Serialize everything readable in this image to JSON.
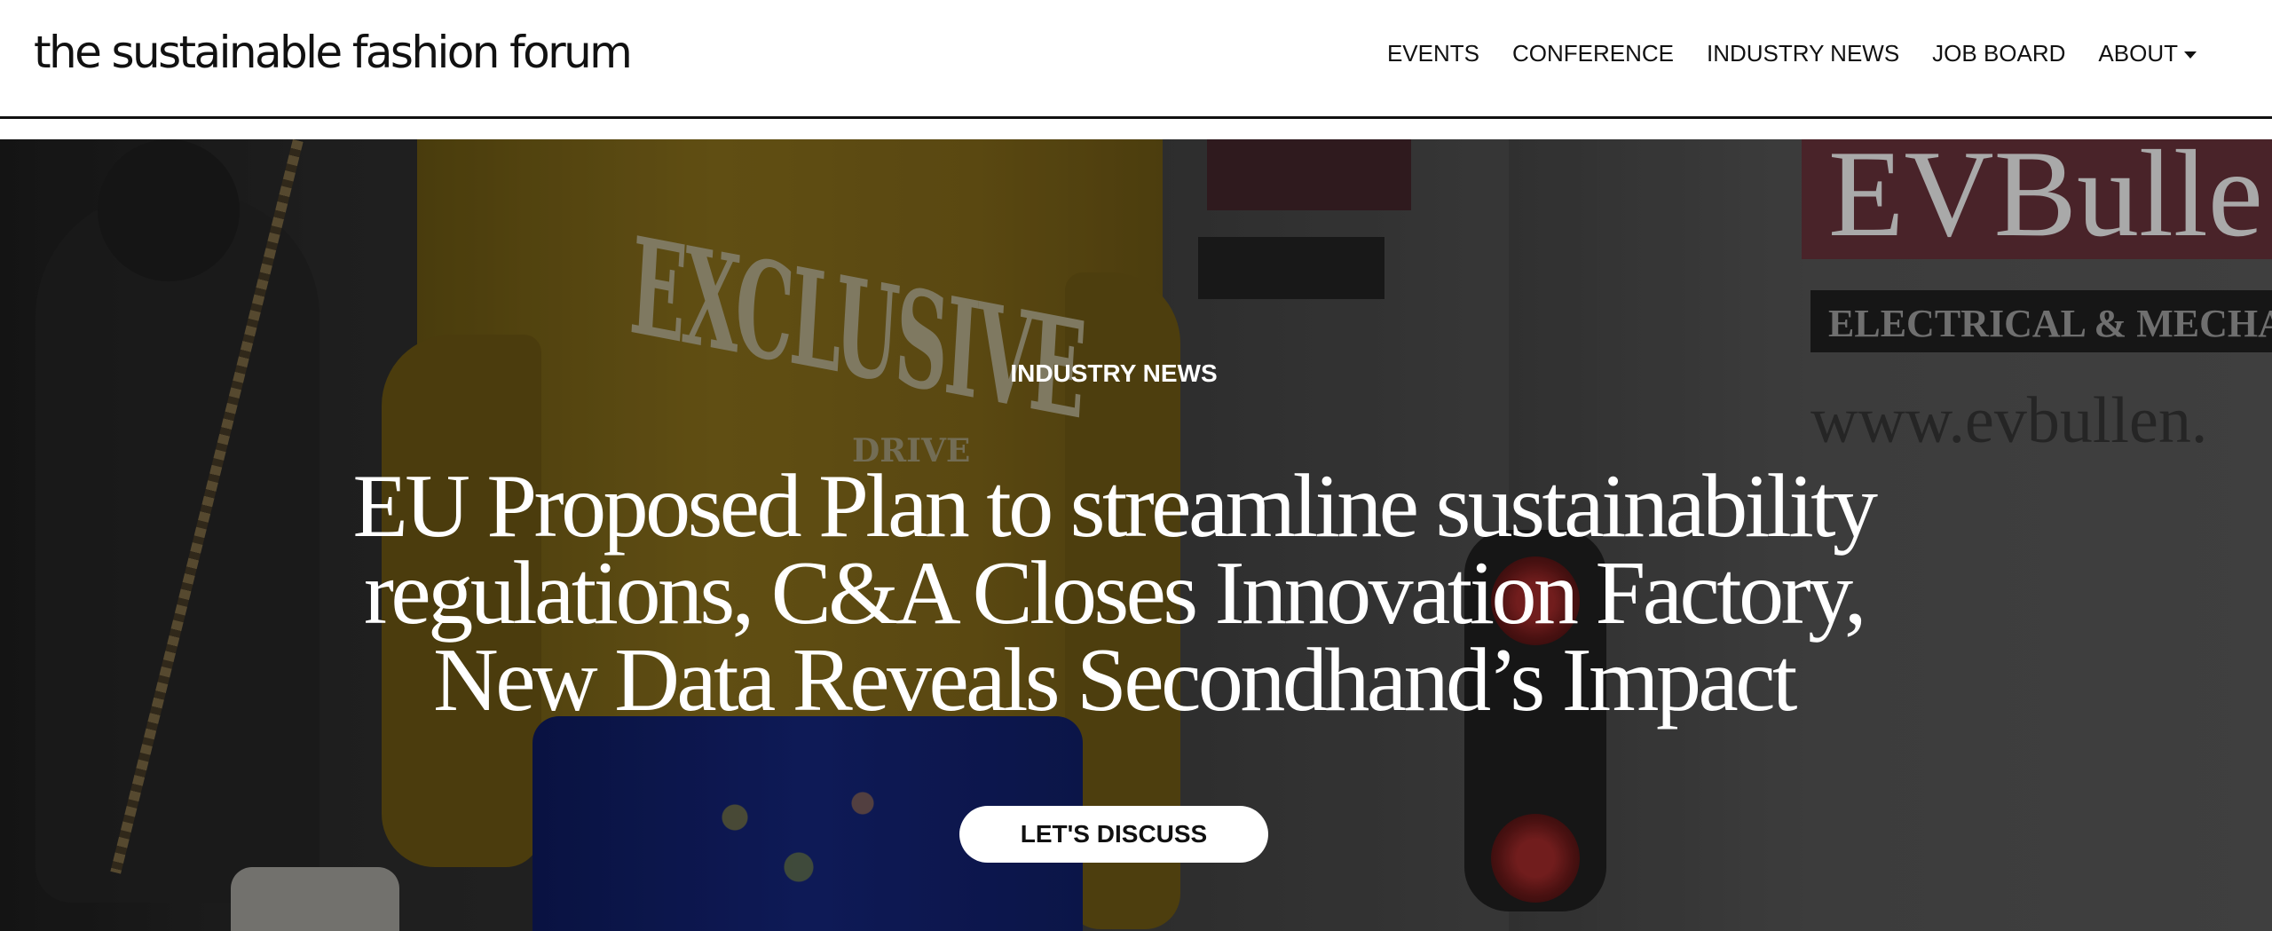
{
  "header": {
    "logo": "the sustainable fashion forum"
  },
  "nav": {
    "items": [
      {
        "label": "EVENTS"
      },
      {
        "label": "CONFERENCE"
      },
      {
        "label": "INDUSTRY NEWS"
      },
      {
        "label": "JOB BOARD"
      },
      {
        "label": "ABOUT",
        "has_dropdown": true
      }
    ]
  },
  "hero": {
    "eyebrow": "INDUSTRY NEWS",
    "headline": "EU Proposed Plan to streamline sustainability regulations, C&A Closes Innovation Factory, New Data Reveals Secondhand’s Impact",
    "cta_label": "LET'S DISCUSS",
    "photo": {
      "sweater_text": "EXCLUSIVE",
      "sweater_subtext": "DRIVE",
      "van_sign_text": "EVBulle",
      "van_sign_subtext": "ELECTRICAL & MECHAN",
      "van_url_text": "www.evbullen."
    }
  },
  "colors": {
    "header_bg": "#ffffff",
    "header_rule": "#111111",
    "sweater_yellow": "#6f5a14",
    "skirt_blue": "#0f1d63",
    "cta_bg": "#ffffff",
    "van_sign_red": "#5a2b33"
  }
}
